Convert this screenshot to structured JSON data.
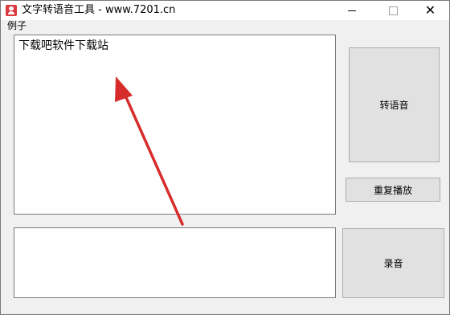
{
  "window": {
    "title": "文字转语音工具 - www.7201.cn"
  },
  "menu": {
    "items": [
      {
        "label": "例子"
      }
    ]
  },
  "main": {
    "text_value": "下载吧软件下载站",
    "lower_value": ""
  },
  "buttons": {
    "convert": "转语音",
    "replay": "重复播放",
    "record": "录音"
  },
  "colors": {
    "arrow": "#d72c2c",
    "app_icon": "#d9393f"
  }
}
